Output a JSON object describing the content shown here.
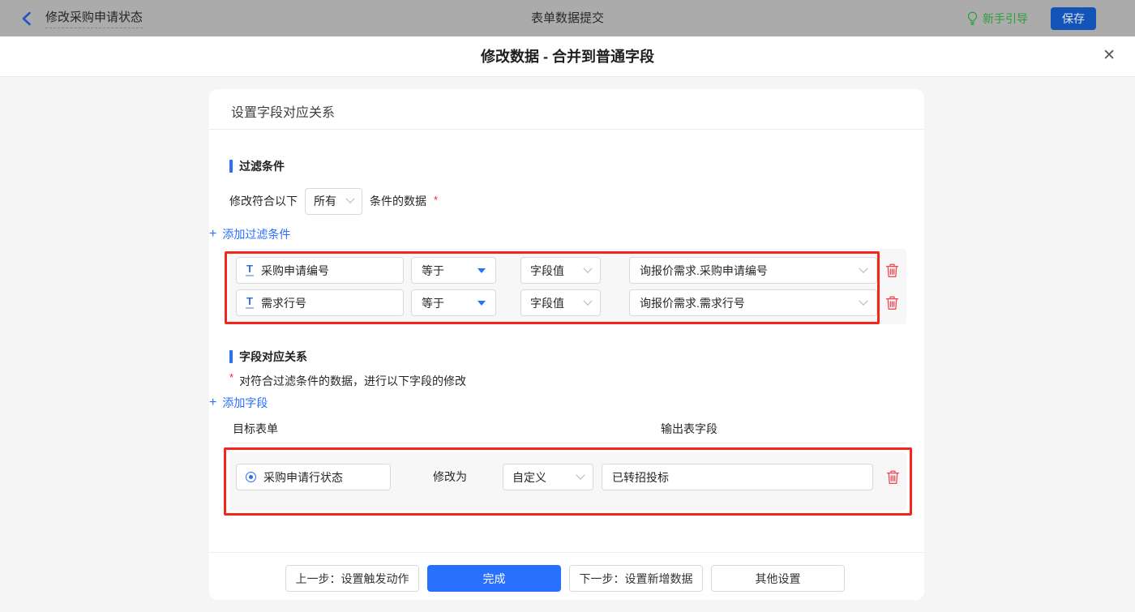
{
  "topbar": {
    "back_label": "修改采购申请状态",
    "center_title": "表单数据提交",
    "guide_label": "新手引导",
    "save_label": "保存"
  },
  "modal": {
    "title": "修改数据 - 合并到普通字段"
  },
  "icons": {
    "close": "✕",
    "plus": "+",
    "asterisk": "*",
    "text_field": "T"
  },
  "card": {
    "header": "设置字段对应关系",
    "filter_section": {
      "title": "过滤条件",
      "match_prefix": "修改符合以下",
      "match_select_value": "所有",
      "match_suffix": "条件的数据",
      "add_link": "添加过滤条件",
      "rows": [
        {
          "field": "采购申请编号",
          "operator": "等于",
          "value_type": "字段值",
          "value": "询报价需求.采购申请编号"
        },
        {
          "field": "需求行号",
          "operator": "等于",
          "value_type": "字段值",
          "value": "询报价需求.需求行号"
        }
      ]
    },
    "mapping_section": {
      "title": "字段对应关系",
      "note": "对符合过滤条件的数据，进行以下字段的修改",
      "add_link": "添加字段",
      "col_target": "目标表单",
      "col_output": "输出表字段",
      "rows": [
        {
          "field": "采购申请行状态",
          "middle_label": "修改为",
          "mode": "自定义",
          "value": "已转招投标"
        }
      ]
    },
    "footer": {
      "prev_label": "上一步：设置触发动作",
      "done_label": "完成",
      "next_label": "下一步：设置新增数据",
      "other_label": "其他设置"
    }
  },
  "colors": {
    "accent_blue": "#2970ff",
    "field_icon_blue": "#2e6bf2",
    "annotation_red": "#f3261b",
    "trash_red": "#f2434e",
    "guide_green": "#2f9e3e",
    "save_button_blue": "#1254b8",
    "topbar_dimmed_gray": "#ababab",
    "page_background": "#f5f5f6",
    "required_red": "#f5222d"
  }
}
